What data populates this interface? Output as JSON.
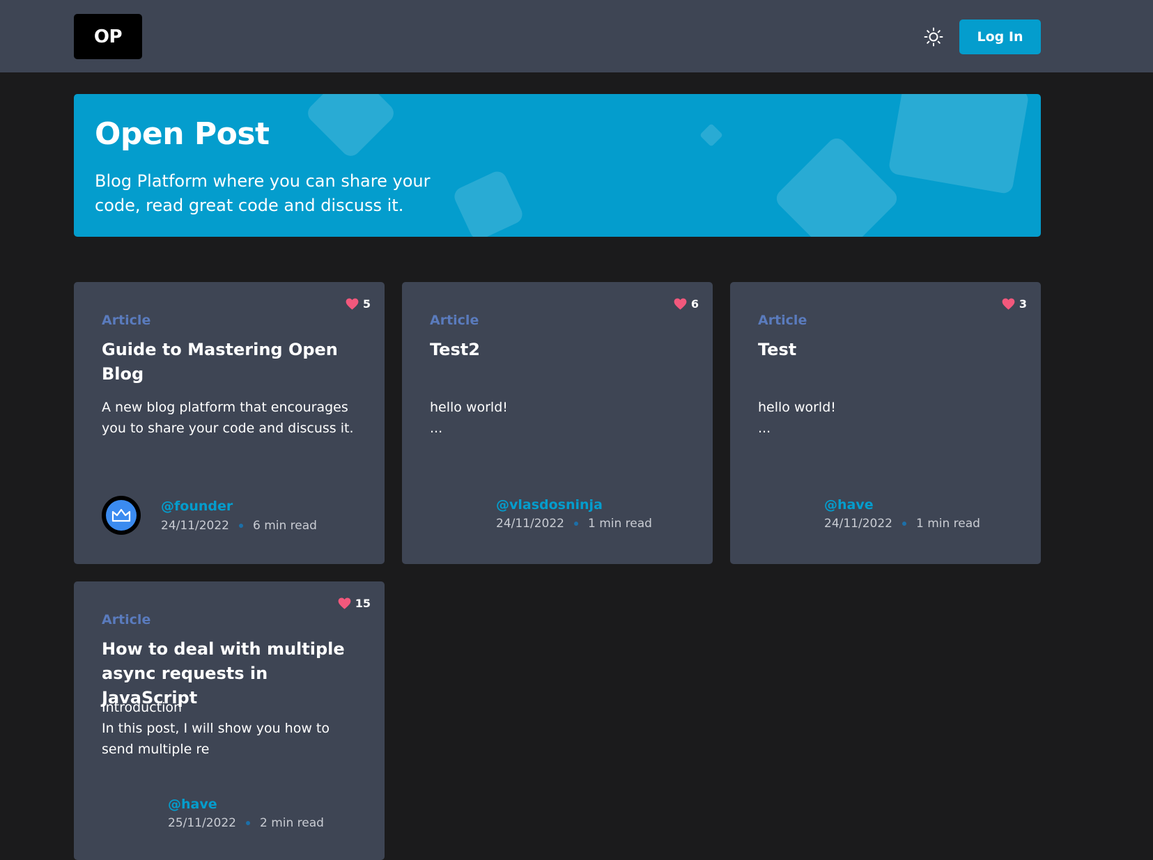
{
  "header": {
    "logo_text": "OP",
    "theme_toggle_icon": "sun-icon",
    "login_label": "Log In"
  },
  "hero": {
    "title": "Open Post",
    "subtitle": "Blog Platform where you can share your code, read great code and discuss it."
  },
  "posts": [
    {
      "type": "Article",
      "title": "Guide to Mastering Open Blog",
      "excerpt": "A new blog platform that encourages you to share your code and discuss it.",
      "author": "@founder",
      "date": "24/11/2022",
      "read_time": "6 min read",
      "likes": "5",
      "avatar_icon": "crown-icon"
    },
    {
      "type": "Article",
      "title": "Test2",
      "excerpt": "hello world!\n...",
      "author": "@vlasdosninja",
      "date": "24/11/2022",
      "read_time": "1 min read",
      "likes": "6"
    },
    {
      "type": "Article",
      "title": "Test",
      "excerpt": "hello world!\n...",
      "author": "@have",
      "date": "24/11/2022",
      "read_time": "1 min read",
      "likes": "3"
    },
    {
      "type": "Article",
      "title": "How to deal with multiple async requests in JavaScript",
      "excerpt": "Introduction\nIn this post, I will show you how to send multiple re",
      "author": "@have",
      "date": "25/11/2022",
      "read_time": "2 min read",
      "likes": "15"
    }
  ],
  "colors": {
    "accent": "#049dcd",
    "header_bg": "#3e4554",
    "page_bg": "#1b1b1c",
    "card_bg": "#3e4554",
    "type_label": "#5a7bbd",
    "heart": "#f2587c"
  }
}
